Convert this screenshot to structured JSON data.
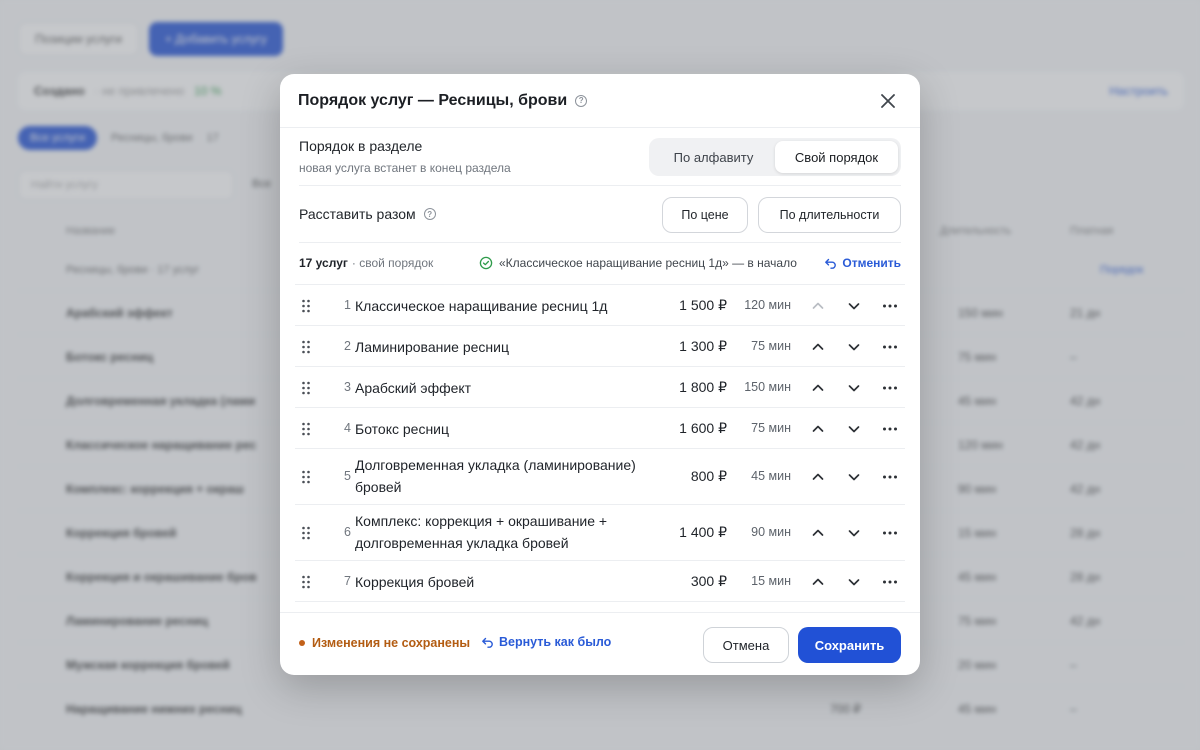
{
  "background": {
    "toolbar": {
      "btn1": "Позиции услуги",
      "btn2": "+ Добавить услугу"
    },
    "summary": {
      "title": "Создано",
      "muted": "· не привлечено",
      "green": "10 %",
      "right": "Настроить"
    },
    "tabs": {
      "active": "Все услуги",
      "t1": "Ресницы, брови",
      "count": "17"
    },
    "search": "Найти услугу",
    "filter": "Все",
    "head": {
      "name": "Название",
      "duration": "Длительность",
      "pay": "Платная"
    },
    "group": {
      "label": "Ресницы, брови · 17 услуг",
      "action": "Порядок"
    },
    "rows": [
      {
        "name": "Арабский эффект",
        "dur": "150 мин",
        "pay": "21 дн"
      },
      {
        "name": "Ботокс ресниц",
        "dur": "75 мин",
        "pay": "–"
      },
      {
        "name": "Долговременная укладка (лами",
        "dur": "45 мин",
        "pay": "42 дн"
      },
      {
        "name": "Классическое наращивание рес",
        "dur": "120 мин",
        "pay": "42 дн"
      },
      {
        "name": "Комплекс: коррекция + окраш",
        "dur": "90 мин",
        "pay": "42 дн"
      },
      {
        "name": "Коррекция бровей",
        "dur": "15 мин",
        "pay": "28 дн"
      },
      {
        "name": "Коррекция и окрашивание бров",
        "dur": "45 мин",
        "pay": "28 дн"
      },
      {
        "name": "Ламинирование ресниц",
        "dur": "75 мин",
        "pay": "42 дн"
      },
      {
        "name": "Мужская коррекция бровей",
        "dur": "20 мин",
        "pay": "–"
      },
      {
        "name": "Наращивание нижних ресниц",
        "price": "700 ₽",
        "dur": "45 мин",
        "pay": "–"
      }
    ]
  },
  "modal": {
    "title": "Порядок услуг — Ресницы, брови",
    "order": {
      "label": "Порядок в разделе",
      "hint": "новая услуга встанет в конец раздела",
      "options": [
        "По алфавиту",
        "Свой порядок"
      ],
      "selected": "Свой порядок"
    },
    "arrange": {
      "label": "Расставить разом",
      "by_price": "По цене",
      "by_duration": "По длительности"
    },
    "status": {
      "count": "17 услуг",
      "mode": "· свой порядок",
      "message": "«Классическое наращивание ресниц 1д» — в начало",
      "undo": "Отменить"
    },
    "services": [
      {
        "num": "1",
        "name": "Классическое наращивание ресниц 1д",
        "price": "1 500 ₽",
        "duration": "120 мин"
      },
      {
        "num": "2",
        "name": "Ламинирование ресниц",
        "price": "1 300 ₽",
        "duration": "75 мин"
      },
      {
        "num": "3",
        "name": "Арабский эффект",
        "price": "1 800 ₽",
        "duration": "150 мин"
      },
      {
        "num": "4",
        "name": "Ботокс ресниц",
        "price": "1 600 ₽",
        "duration": "75 мин"
      },
      {
        "num": "5",
        "name": "Долговременная укладка (ламинирование) бровей",
        "price": "800 ₽",
        "duration": "45 мин"
      },
      {
        "num": "6",
        "name": "Комплекс: коррекция + окрашивание + долговременная укладка бровей",
        "price": "1 400 ₽",
        "duration": "90 мин"
      },
      {
        "num": "7",
        "name": "Коррекция бровей",
        "price": "300 ₽",
        "duration": "15 мин"
      }
    ],
    "footer": {
      "unsaved": "Изменения не сохранены",
      "revert": "Вернуть как было",
      "cancel": "Отмена",
      "save": "Сохранить"
    }
  },
  "colors": {
    "accent": "#2151d6",
    "warning": "#b35c12",
    "success": "#2e9b4a"
  }
}
